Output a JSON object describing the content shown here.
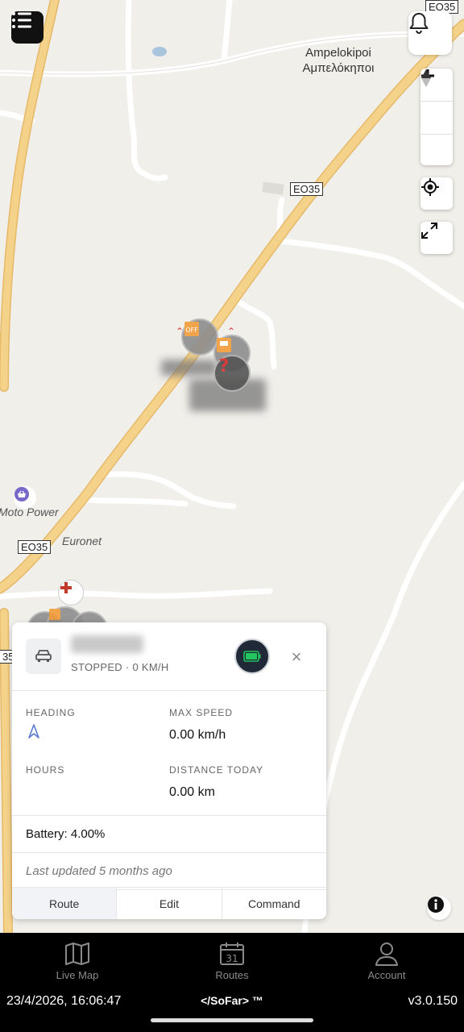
{
  "map": {
    "place_name_latin": "Ampelokipoi",
    "place_name_greek": "Αμπελόκηποι",
    "road_labels": [
      "EO35",
      "EO35",
      "EO35",
      "35"
    ],
    "poi_moto": "Moto Power",
    "poi_euronet": "Euronet"
  },
  "card": {
    "status": "STOPPED · 0 KM/H",
    "heading_label": "HEADING",
    "max_speed_label": "MAX SPEED",
    "max_speed_value": "0.00 km/h",
    "hours_label": "HOURS",
    "distance_label": "DISTANCE TODAY",
    "distance_value": "0.00 km",
    "battery": "Battery: 4.00%",
    "last_updated": "Last updated 5 months ago",
    "close_symbol": "×",
    "tabs": [
      "Route",
      "Edit",
      "Command"
    ]
  },
  "nav": {
    "live_map": "Live Map",
    "routes": "Routes",
    "routes_day": "31",
    "account": "Account"
  },
  "status_bar": {
    "datetime": "23/4/2026, 16:06:47",
    "brand": "</SoFar> ™",
    "version": "v3.0.150"
  },
  "colors": {
    "main_road": "#f4d28a",
    "battery_green": "#22c55e",
    "hospital_red": "#c0392b"
  }
}
